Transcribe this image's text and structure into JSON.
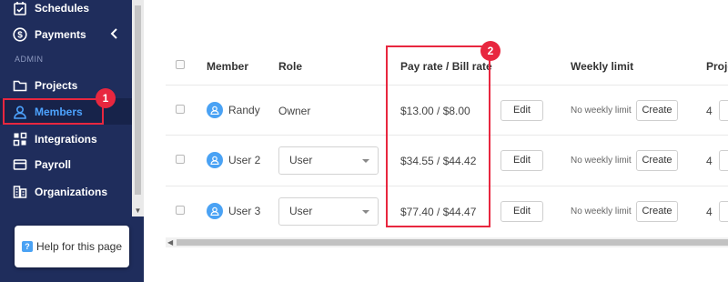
{
  "sidebar": {
    "section_label": "ADMIN",
    "items": [
      {
        "label": "Schedules",
        "icon": "calendar-check-icon"
      },
      {
        "label": "Payments",
        "icon": "dollar-circle-icon"
      },
      {
        "label": "Projects",
        "icon": "folder-icon"
      },
      {
        "label": "Members",
        "icon": "user-icon",
        "active": true
      },
      {
        "label": "Integrations",
        "icon": "puzzle-icon"
      },
      {
        "label": "Payroll",
        "icon": "payroll-icon"
      },
      {
        "label": "Organizations",
        "icon": "building-icon"
      }
    ],
    "help": {
      "label": "Help for this page",
      "icon": "question-icon"
    }
  },
  "table": {
    "headers": {
      "member": "Member",
      "role": "Role",
      "pay_rate": "Pay rate / Bill rate",
      "weekly_limit": "Weekly limit",
      "projects": "Proje"
    },
    "rows": [
      {
        "member": "Randy",
        "role": "Owner",
        "rate": "$13.00 / $8.00",
        "edit": "Edit",
        "limit": "No weekly limit",
        "create": "Create",
        "projects": "4"
      },
      {
        "member": "User 2",
        "role": "User",
        "rate": "$34.55 / $44.42",
        "edit": "Edit",
        "limit": "No weekly limit",
        "create": "Create",
        "projects": "4"
      },
      {
        "member": "User 3",
        "role": "User",
        "rate": "$77.40 / $44.47",
        "edit": "Edit",
        "limit": "No weekly limit",
        "create": "Create",
        "projects": "4"
      }
    ]
  },
  "annotations": {
    "badge1": "1",
    "badge2": "2"
  },
  "colors": {
    "sidebar": "#1f2d5c",
    "active_text": "#4da3ff",
    "highlight": "#e8273f",
    "avatar": "#4aa2f4"
  }
}
